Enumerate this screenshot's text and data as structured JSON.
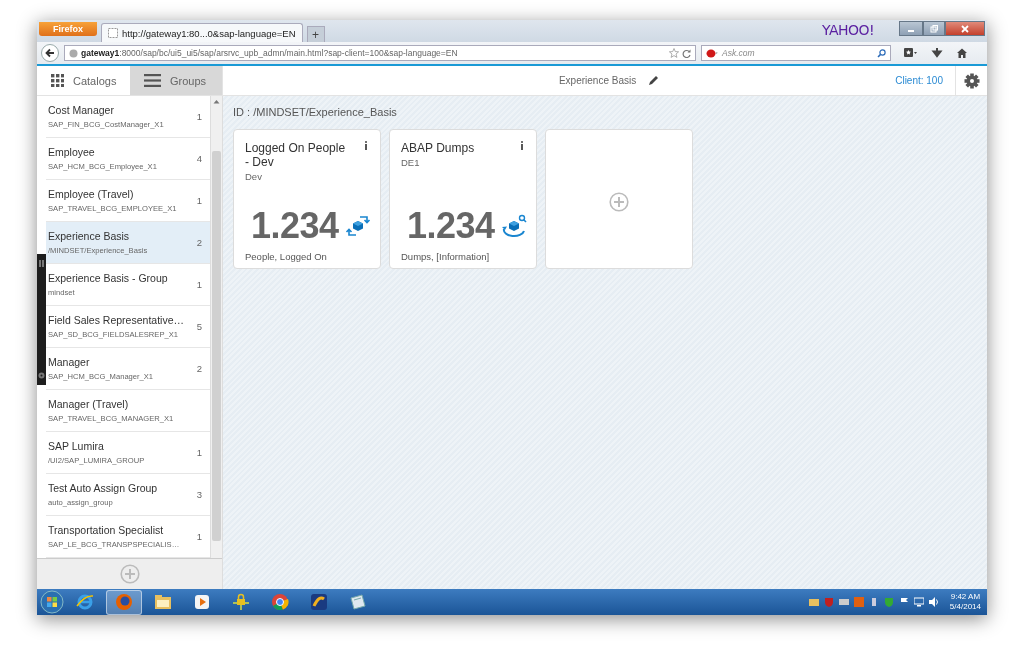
{
  "browser": {
    "menu_button": "Firefox",
    "tab_title": "http://gateway1:80...0&sap-language=EN",
    "new_tab": "+",
    "brand": "YAHOO!",
    "url_host": "gateway1",
    "url_rest": ":8000/sap/bc/ui5_ui5/sap/arsrvc_upb_admn/main.html?sap-client=100&sap-language=EN",
    "search_placeholder": "Ask.com"
  },
  "header": {
    "title": "Experience Basis",
    "client": "Client: 100"
  },
  "sidebar": {
    "tabs": [
      {
        "label": "Catalogs",
        "selected": false
      },
      {
        "label": "Groups",
        "selected": true
      }
    ],
    "items": [
      {
        "title": "Cost Manager",
        "subtitle": "SAP_FIN_BCG_CostManager_X1",
        "count": "1",
        "selected": false
      },
      {
        "title": "Employee",
        "subtitle": "SAP_HCM_BCG_Employee_X1",
        "count": "4",
        "selected": false
      },
      {
        "title": "Employee (Travel)",
        "subtitle": "SAP_TRAVEL_BCG_EMPLOYEE_X1",
        "count": "1",
        "selected": false
      },
      {
        "title": "Experience Basis",
        "subtitle": "/MINDSET/Experience_Basis",
        "count": "2",
        "selected": true
      },
      {
        "title": "Experience Basis - Group",
        "subtitle": "mindset",
        "count": "1",
        "selected": false
      },
      {
        "title": "Field Sales Representative…",
        "subtitle": "SAP_SD_BCG_FIELDSALESREP_X1",
        "count": "5",
        "selected": false
      },
      {
        "title": "Manager",
        "subtitle": "SAP_HCM_BCG_Manager_X1",
        "count": "2",
        "selected": false
      },
      {
        "title": "Manager (Travel)",
        "subtitle": "SAP_TRAVEL_BCG_MANAGER_X1",
        "selected": false
      },
      {
        "title": "SAP Lumira",
        "subtitle": "/UI2/SAP_LUMIRA_GROUP",
        "count": "1",
        "selected": false
      },
      {
        "title": "Test Auto Assign Group",
        "subtitle": "auto_assign_group",
        "count": "3",
        "selected": false
      },
      {
        "title": "Transportation Specialist",
        "subtitle": "SAP_LE_BCG_TRANSPSPECIALIS…",
        "count": "1",
        "selected": false
      }
    ]
  },
  "content": {
    "id_label": "ID : /MINDSET/Experience_Basis",
    "tiles": [
      {
        "kind": "kpi",
        "title": "Logged On People - Dev",
        "subtitle": "Dev",
        "value": "1.234",
        "footer": "People, Logged On"
      },
      {
        "kind": "kpi",
        "title": "ABAP Dumps",
        "subtitle": "DE1",
        "value": "1.234",
        "footer": "Dumps, [Information]"
      },
      {
        "kind": "add"
      }
    ]
  },
  "taskbar": {
    "apps": [
      {
        "selected": false
      },
      {
        "selected": true
      },
      {
        "selected": false
      },
      {
        "selected": false
      },
      {
        "selected": false
      },
      {
        "selected": false
      },
      {
        "selected": false
      },
      {
        "selected": false
      }
    ],
    "time": "9:42 AM",
    "date": "5/4/2014"
  }
}
